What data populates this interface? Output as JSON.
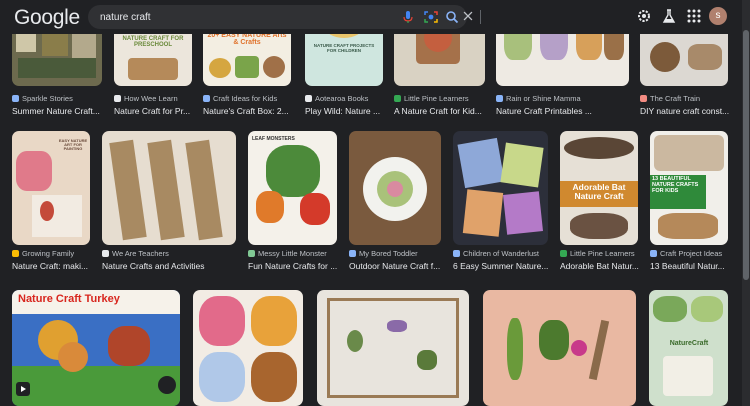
{
  "header": {
    "logo": "Google",
    "query": "nature craft",
    "avatar_letter": "s"
  },
  "icons": {
    "clear": "close-icon",
    "voice": "microphone-icon",
    "lens": "camera-lens-icon",
    "search": "search-icon",
    "settings": "gear-icon",
    "labs": "flask-icon",
    "apps": "apps-grid-icon",
    "play": "play-icon"
  },
  "colors": {
    "background": "#202124",
    "search_bg": "#303134",
    "text": "#e8eaed",
    "muted": "#bdc1c6",
    "accent_blue": "#8ab4f8"
  },
  "results": {
    "row1": [
      {
        "source": "Sparkle Stories",
        "title": "Summer Nature Craft..."
      },
      {
        "source": "How Wee Learn",
        "title": "Nature Craft for Pr...",
        "overlay": "NATURE CRAFT FOR PRESCHOOL"
      },
      {
        "source": "Craft Ideas for Kids",
        "title": "Nature's Craft Box: 2...",
        "overlay": "20+ EASY NATURE Arts & Crafts"
      },
      {
        "source": "Aotearoa Books",
        "title": "Play Wild: Nature ...",
        "overlay": "NATURE CRAFT PROJECTS FOR CHILDREN"
      },
      {
        "source": "Little Pine Learners",
        "title": "A Nature Craft for Kid..."
      },
      {
        "source": "Rain or Shine Mamma",
        "title": "Nature Craft Printables ..."
      },
      {
        "source": "The Craft Train",
        "title": "DIY nature craft const..."
      }
    ],
    "row2": [
      {
        "source": "Growing Family",
        "title": "Nature Craft: maki...",
        "overlay": "EASY NATURE ART FOR PAINTING"
      },
      {
        "source": "We Are Teachers",
        "title": "Nature Crafts and Activities"
      },
      {
        "source": "Messy Little Monster",
        "title": "Fun Nature Crafts for ...",
        "overlay": "LEAF MONSTERS"
      },
      {
        "source": "My Bored Toddler",
        "title": "Outdoor Nature Craft f..."
      },
      {
        "source": "Children of Wanderlust",
        "title": "6 Easy Summer Nature..."
      },
      {
        "source": "Little Pine Learners",
        "title": "Adorable Bat Natur...",
        "overlay": "Adorable Bat Nature Craft"
      },
      {
        "source": "Craft Project Ideas",
        "title": "13 Beautiful Natur...",
        "overlay": "13 BEAUTIFUL NATURE CRAFTS FOR KIDS"
      }
    ],
    "row3": [
      {
        "overlay": "Nature Craft Turkey"
      },
      {},
      {},
      {},
      {
        "overlay": "NatureCraft"
      }
    ]
  }
}
